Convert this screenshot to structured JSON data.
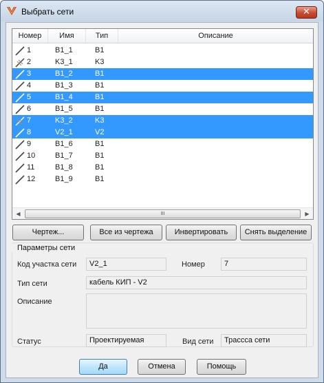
{
  "window": {
    "title": "Выбрать сети",
    "close_label": "✕"
  },
  "list": {
    "columns": [
      "Номер",
      "Имя",
      "Тип",
      "Описание"
    ],
    "rows": [
      {
        "num": "1",
        "name": "B1_1",
        "type": "B1",
        "icon": "network-line-icon",
        "selected": false
      },
      {
        "num": "2",
        "name": "K3_1",
        "type": "K3",
        "icon": "network-cable-icon",
        "selected": false
      },
      {
        "num": "3",
        "name": "B1_2",
        "type": "B1",
        "icon": "network-line-icon",
        "selected": true
      },
      {
        "num": "4",
        "name": "B1_3",
        "type": "B1",
        "icon": "network-line-icon",
        "selected": false
      },
      {
        "num": "5",
        "name": "B1_4",
        "type": "B1",
        "icon": "network-line-icon",
        "selected": true
      },
      {
        "num": "6",
        "name": "B1_5",
        "type": "B1",
        "icon": "network-line-icon",
        "selected": false
      },
      {
        "num": "7",
        "name": "K3_2",
        "type": "K3",
        "icon": "network-cable-icon",
        "selected": true
      },
      {
        "num": "8",
        "name": "V2_1",
        "type": "V2",
        "icon": "network-line-icon",
        "selected": true
      },
      {
        "num": "9",
        "name": "B1_6",
        "type": "B1",
        "icon": "network-line-icon",
        "selected": false
      },
      {
        "num": "10",
        "name": "B1_7",
        "type": "B1",
        "icon": "network-line-icon",
        "selected": false
      },
      {
        "num": "11",
        "name": "B1_8",
        "type": "B1",
        "icon": "network-line-icon",
        "selected": false
      },
      {
        "num": "12",
        "name": "B1_9",
        "type": "B1",
        "icon": "network-line-icon",
        "selected": false
      }
    ],
    "scroll": {
      "left": "◀",
      "right": "▶",
      "grip": "III"
    }
  },
  "actions": {
    "drawing": "Чертеж...",
    "all_from_drawing": "Все из чертежа",
    "invert": "Инвертировать",
    "clear_selection": "Снять выделение"
  },
  "params": {
    "title": "Параметры сети",
    "code_label": "Код участка сети",
    "code_value": "V2_1",
    "number_label": "Номер",
    "number_value": "7",
    "type_label": "Тип сети",
    "type_value": "кабель КИП - V2",
    "description_label": "Описание",
    "description_value": "",
    "status_label": "Статус",
    "status_value": "Проектируемая",
    "kind_label": "Вид сети",
    "kind_value": "Трассса сети"
  },
  "footer": {
    "ok": "Да",
    "cancel": "Отмена",
    "help": "Помощь"
  },
  "colors": {
    "selection": "#3399ff",
    "frame": "#cfdbe8",
    "close": "#c74a31"
  }
}
